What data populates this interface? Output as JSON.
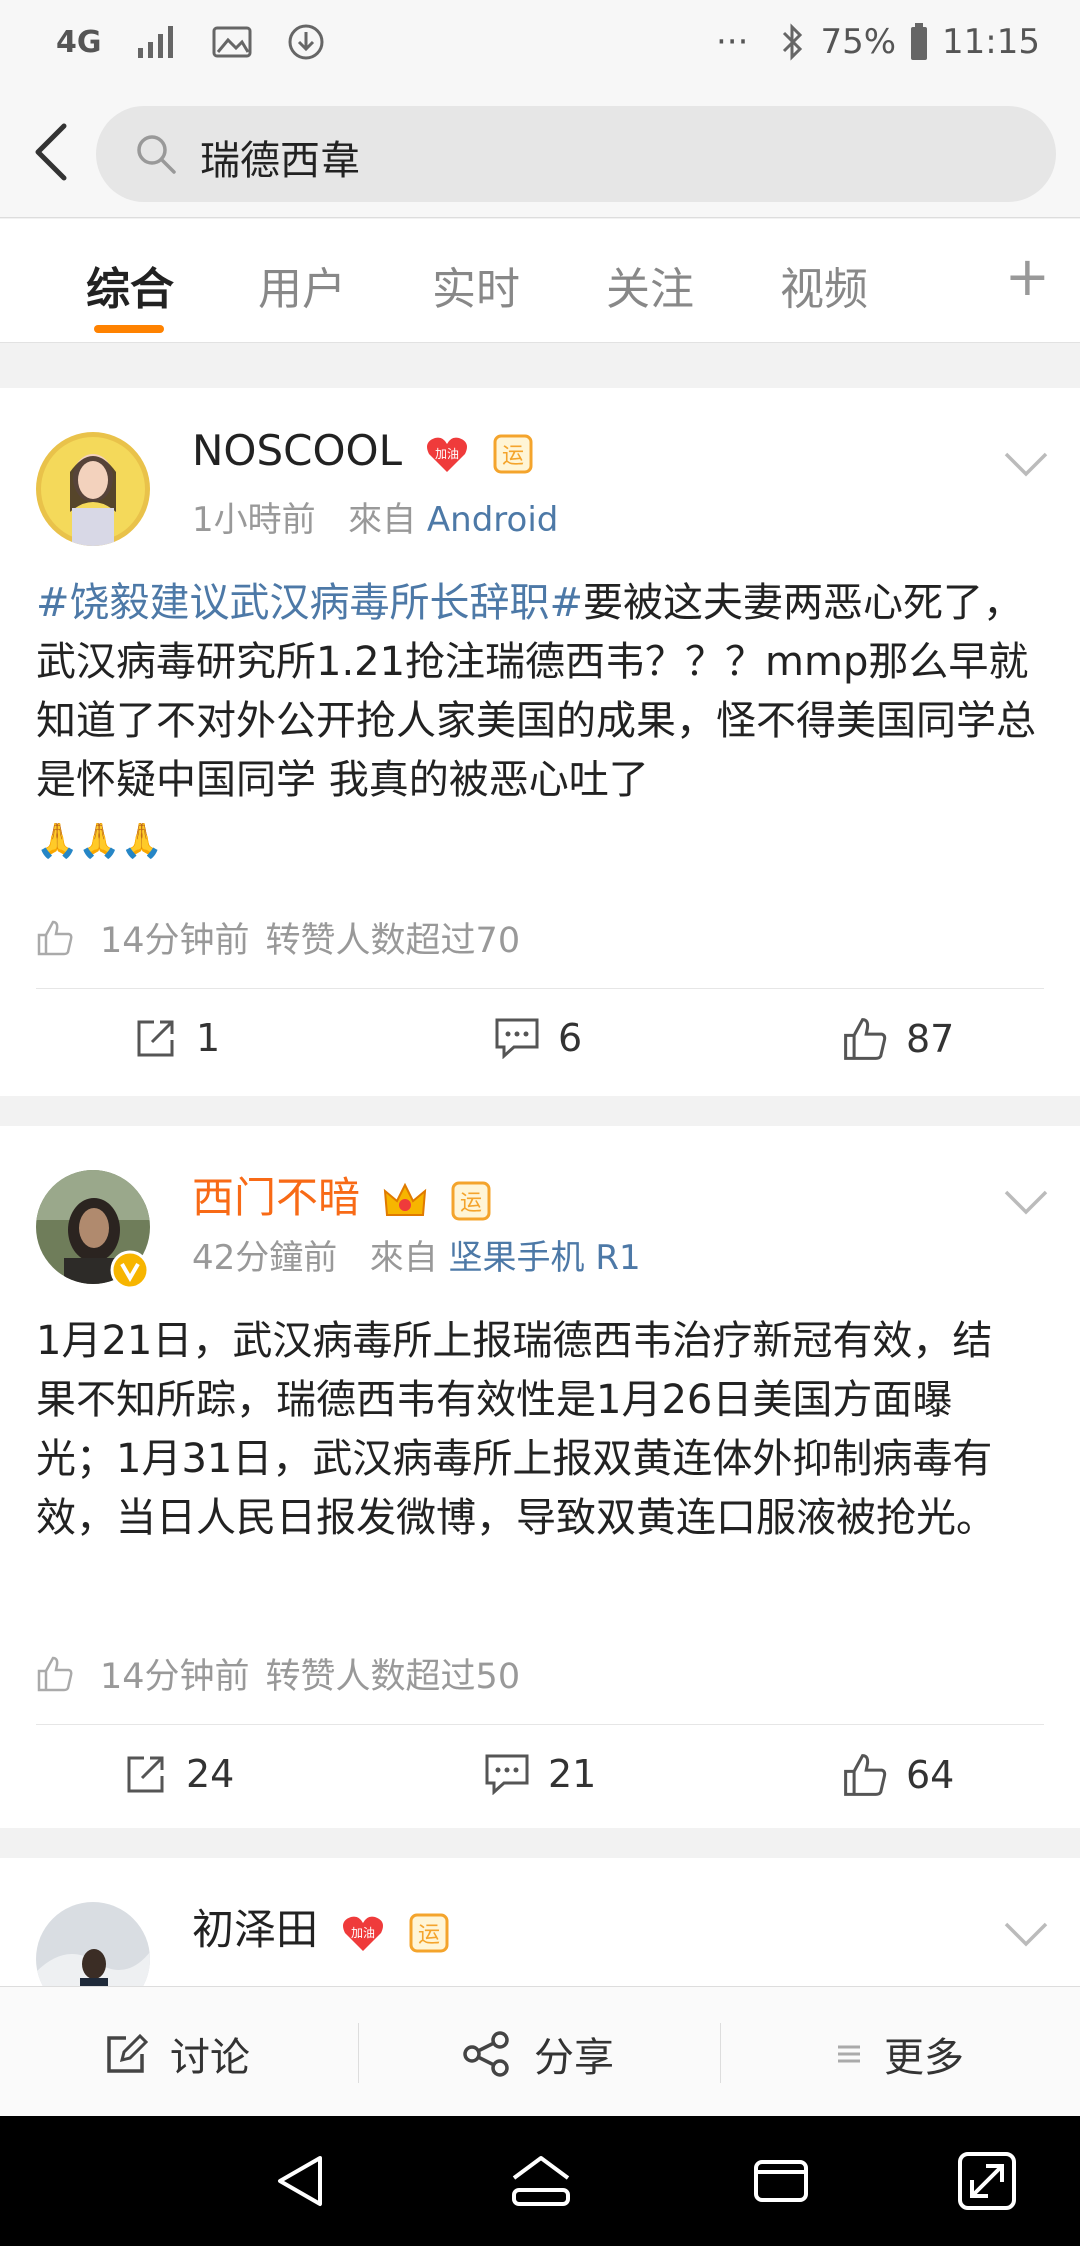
{
  "status_bar": {
    "network": "4G",
    "battery": "75%",
    "time": "11:15",
    "dots": "···"
  },
  "search": {
    "query": "瑞德西韋"
  },
  "tabs": [
    {
      "label": "综合",
      "active": true
    },
    {
      "label": "用户"
    },
    {
      "label": "实时"
    },
    {
      "label": "关注"
    },
    {
      "label": "视频"
    }
  ],
  "tabs_plus": "+",
  "posts": [
    {
      "username": "NOSCOOL",
      "badges": [
        "加油",
        "运"
      ],
      "time": "1小時前",
      "from_label": "來自",
      "source": "Android",
      "topic": "#饶毅建议武汉病毒所长辞职#",
      "text": "要被这夫妻两恶心死了，武汉病毒研究所1.21抢注瑞德西韦？？？mmp那么早就知道了不对外公开抢人家美国的成果，怪不得美国同学总是怀疑中国同学 我真的被恶心吐了",
      "emoji": "🙏🙏🙏",
      "repost_time": "14分钟前",
      "repost_note": "转赞人数超过70",
      "shares": "1",
      "comments": "6",
      "likes": "87"
    },
    {
      "username": "西门不暗",
      "badges": [
        "crown",
        "运"
      ],
      "time": "42分鐘前",
      "from_label": "來自",
      "source": "坚果手机 R1",
      "text": "1月21日，武汉病毒所上报瑞德西韦治疗新冠有效，结果不知所踪，瑞德西韦有效性是1月26日美国方面曝光；1月31日，武汉病毒所上报双黄连体外抑制病毒有效，当日人民日报发微博，导致双黄连口服液被抢光。",
      "repost_time": "14分钟前",
      "repost_note": "转赞人数超过50",
      "shares": "24",
      "comments": "21",
      "likes": "64"
    },
    {
      "username": "初泽田",
      "badges": [
        "加油",
        "运"
      ]
    }
  ],
  "bottom_bar": {
    "discuss": "讨论",
    "share": "分享",
    "more": "更多"
  },
  "colors": {
    "accent": "#ff8200",
    "link": "#4d79a7",
    "orange_name": "#f86a16"
  }
}
